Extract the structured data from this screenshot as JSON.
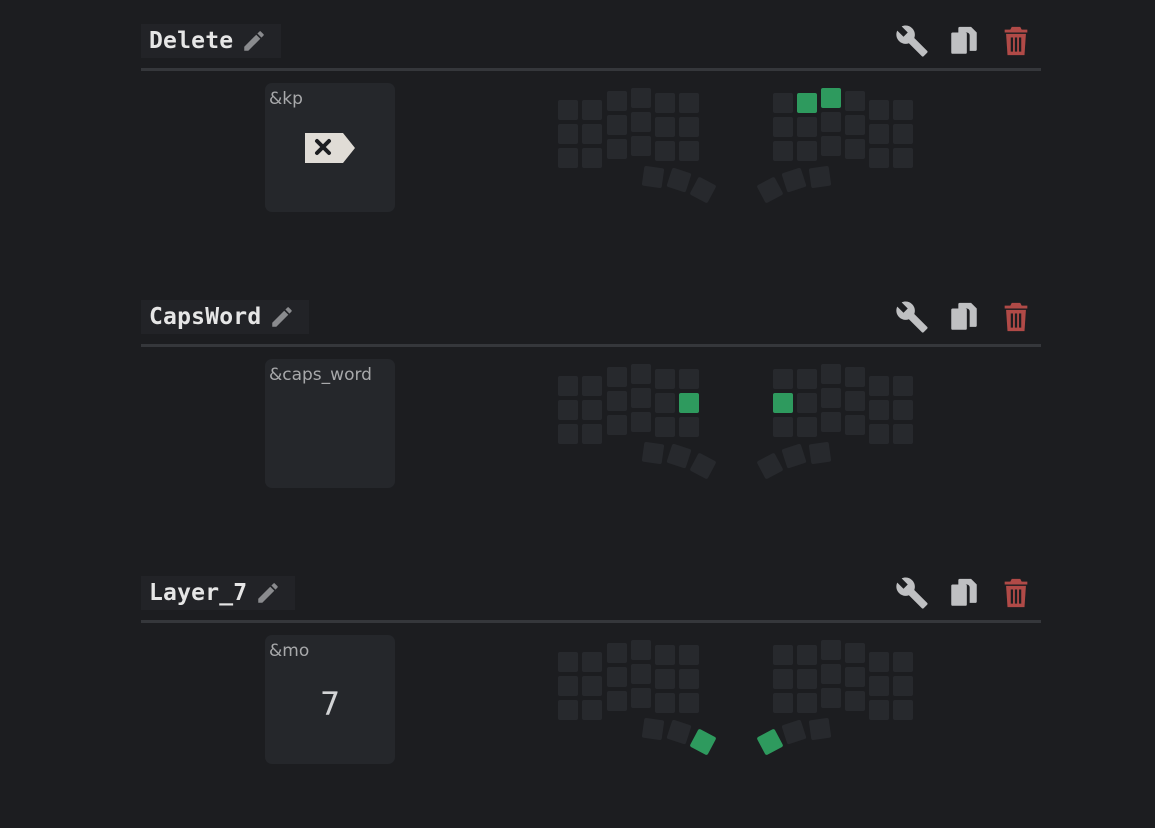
{
  "combos": [
    {
      "name": "Delete",
      "binding": "&kp",
      "param": "",
      "param_icon": "backspace-icon",
      "active_keys": [
        "R10",
        "R20"
      ]
    },
    {
      "name": "CapsWord",
      "binding": "&caps_word",
      "param": "",
      "param_icon": "",
      "active_keys": [
        "L51",
        "R01"
      ]
    },
    {
      "name": "Layer_7",
      "binding": "&mo",
      "param": "7",
      "param_icon": "",
      "active_keys": [
        "LT2",
        "RT0"
      ]
    }
  ],
  "icons": {
    "edit": "pencil-icon",
    "settings": "wrench-icon",
    "duplicate": "copy-icon",
    "delete": "trash-icon"
  },
  "colors": {
    "background": "#1c1d20",
    "panel": "#25272b",
    "key_inactive": "#27292d",
    "key_active": "#2e9a5e",
    "delete_icon": "#b04a47",
    "tool_icon": "#bfc0c2"
  }
}
